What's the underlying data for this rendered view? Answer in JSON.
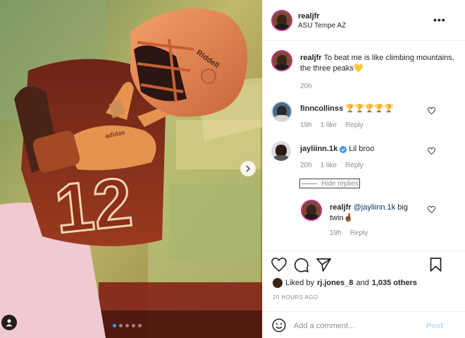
{
  "header": {
    "username": "realjfr",
    "location": "ASU Tempe AZ",
    "more_label": "•••"
  },
  "caption": {
    "username": "realjfr",
    "text": "To beat me is like climbing mountains, the three peaks💛",
    "time": "20h"
  },
  "comments": [
    {
      "username": "finncollinss",
      "text": "🏆🏆🏆🏆🏆",
      "time": "19h",
      "likes": "1 like",
      "reply": "Reply"
    },
    {
      "username": "jayliinn.1k",
      "verified": true,
      "text": "Lil broo",
      "time": "20h",
      "likes": "1 like",
      "reply": "Reply"
    }
  ],
  "hide_replies_label": "Hide replies",
  "reply": {
    "username": "realjfr",
    "mention": "@jayliinn.1k",
    "text_line1": "big",
    "text_line2": "twin🤞🏾",
    "time": "19h",
    "reply": "Reply"
  },
  "likes": {
    "prefix": "Liked by",
    "user": "rj.jones_8",
    "and": "and",
    "others": "1,035 others"
  },
  "timestamp": "20 HOURS AGO",
  "add_comment": {
    "placeholder": "Add a comment...",
    "post_label": "Post"
  },
  "media": {
    "jersey_number": "12",
    "helmet_brand": "Riddell",
    "glove_brand": "adidas",
    "carousel_total": 5,
    "carousel_active": 1
  },
  "colors": {
    "link_blue": "#00376b",
    "post_disabled": "#b2dffc",
    "meta_gray": "#8e8e8e",
    "carousel_active": "#3897f0"
  }
}
